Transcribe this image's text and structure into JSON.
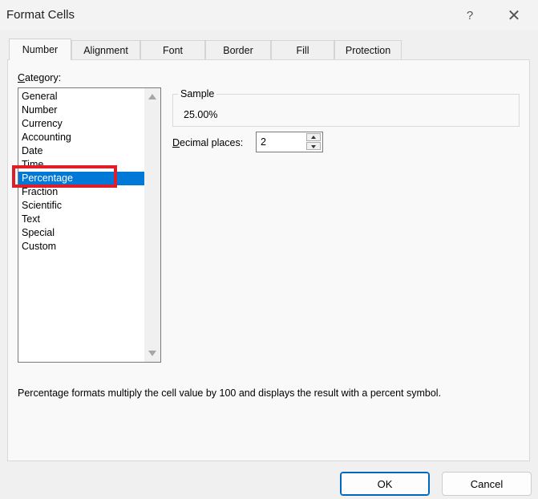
{
  "window": {
    "title": "Format Cells",
    "help": "?",
    "close": "✕"
  },
  "tabs": [
    {
      "label": "Number",
      "active": true
    },
    {
      "label": "Alignment",
      "active": false
    },
    {
      "label": "Font",
      "active": false
    },
    {
      "label": "Border",
      "active": false
    },
    {
      "label": "Fill",
      "active": false
    },
    {
      "label": "Protection",
      "active": false
    }
  ],
  "category": {
    "label_accel": "C",
    "label_rest": "ategory:",
    "items": [
      "General",
      "Number",
      "Currency",
      "Accounting",
      "Date",
      "Time",
      "Percentage",
      "Fraction",
      "Scientific",
      "Text",
      "Special",
      "Custom"
    ],
    "selected": "Percentage"
  },
  "sample": {
    "legend": "Sample",
    "value": "25.00%"
  },
  "decimal_places": {
    "label_accel": "D",
    "label_rest": "ecimal places:",
    "value": "2"
  },
  "description": "Percentage formats multiply the cell value by 100 and displays the result with a percent symbol.",
  "buttons": {
    "ok": "OK",
    "cancel": "Cancel"
  },
  "colors": {
    "selection": "#0078d7",
    "highlight_box": "#e01e2a"
  }
}
